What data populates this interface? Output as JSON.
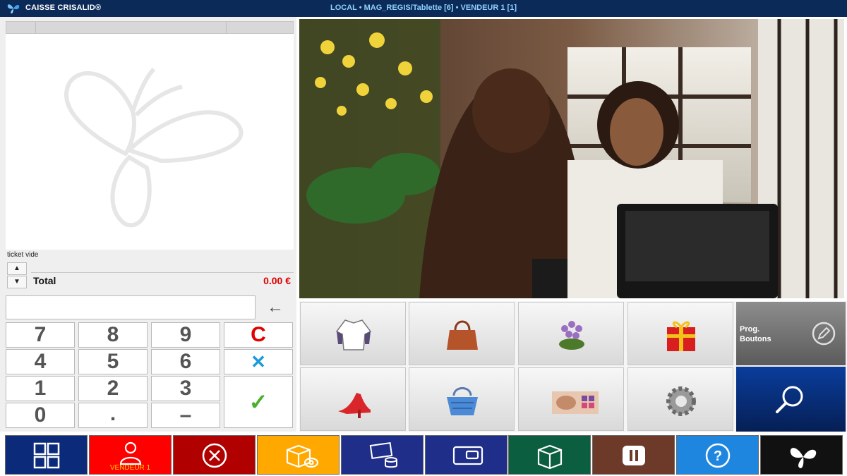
{
  "titlebar": {
    "app_name": "CAISSE CRISALID®",
    "session": "LOCAL  •  MAG_REGIS/Tablette [6]  •  VENDEUR 1 [1]"
  },
  "ticket": {
    "status": "ticket vide",
    "total_label": "Total",
    "total_value": "0.00 €",
    "scroll_up": "▲",
    "scroll_down": "▼"
  },
  "entry": {
    "value": "",
    "backspace": "←"
  },
  "keypad": {
    "k7": "7",
    "k8": "8",
    "k9": "9",
    "clear": "C",
    "k4": "4",
    "k5": "5",
    "k6": "6",
    "cancel": "✕",
    "k1": "1",
    "k2": "2",
    "k3": "3",
    "validate": "✓",
    "k0": "0",
    "dot": ".",
    "minus": "–"
  },
  "categories": [
    {
      "icon": "sweater-icon"
    },
    {
      "icon": "handbag-icon"
    },
    {
      "icon": "flowers-icon"
    },
    {
      "icon": "gift-icon"
    },
    {
      "icon": "high-heel-icon"
    },
    {
      "icon": "basket-icon"
    },
    {
      "icon": "makeup-icon"
    },
    {
      "icon": "gear-icon"
    }
  ],
  "prog_buttons": {
    "label": "Prog. Boutons"
  },
  "function_bar": [
    {
      "icon": "grid-icon",
      "color": "#0b2a7a"
    },
    {
      "icon": "user-icon",
      "color": "#ff0000",
      "label": "VENDEUR 1"
    },
    {
      "icon": "cancel-circle-icon",
      "color": "#b00000"
    },
    {
      "icon": "box-eye-icon",
      "color": "#ffa800"
    },
    {
      "icon": "cash-icon",
      "color": "#1f2e88"
    },
    {
      "icon": "card-icon",
      "color": "#1f2e88"
    },
    {
      "icon": "package-icon",
      "color": "#0b5e40"
    },
    {
      "icon": "pause-icon",
      "color": "#6d3a2a"
    },
    {
      "icon": "help-icon",
      "color": "#1f86e0"
    },
    {
      "icon": "butterfly-icon",
      "color": "#111111"
    }
  ],
  "colors": {
    "titlebar": "#0b2a57",
    "total": "#e00000",
    "clear_key": "#e00000",
    "cancel_key": "#1a9ad8",
    "validate_key": "#49b02a"
  }
}
